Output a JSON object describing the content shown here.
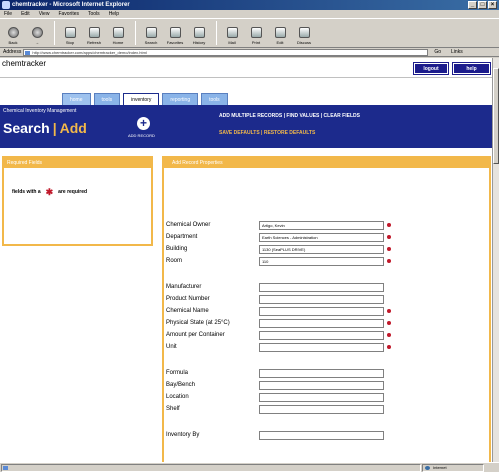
{
  "window": {
    "title": "chemtracker - Microsoft Internet Explorer",
    "controls": [
      "_",
      "□",
      "×"
    ]
  },
  "menu": [
    "File",
    "Edit",
    "View",
    "Favorites",
    "Tools",
    "Help"
  ],
  "toolbar": {
    "buttons": [
      "Back",
      "→",
      "Stop",
      "Refresh",
      "Home",
      "Search",
      "Favorites",
      "History",
      "Mail",
      "Print",
      "Edit",
      "Discuss"
    ]
  },
  "address": {
    "label": "Address",
    "url": "http://www.chemtracker.com/apps/chemtracker_demo/index.html",
    "go": "Go",
    "links": "Links"
  },
  "app": {
    "name": "chemtracker",
    "logout_label": "logout",
    "help_label": "help"
  },
  "tabs": [
    {
      "label": "home",
      "active": false
    },
    {
      "label": "tools",
      "active": false
    },
    {
      "label": "inventory",
      "active": true
    },
    {
      "label": "reporting",
      "active": false
    },
    {
      "label": "tools",
      "active": false
    }
  ],
  "banner": {
    "system": "Chemical Inventory Management",
    "crumb_search": "Search",
    "crumb_sep": "|",
    "crumb_add": "Add",
    "add_records_label": "ADD RECORD",
    "links_top": "ADD MULTIPLE RECORDS  |  FIND VALUES  |  CLEAR FIELDS",
    "links_bottom": "SAVE DEFAULTS  |  RESTORE DEFAULTS"
  },
  "left_panel": {
    "heading": "Required Fields",
    "req_prefix": "fields with a",
    "req_star": "✱",
    "req_suffix": "are required"
  },
  "form": {
    "heading": "Add Record Properties",
    "fields": [
      {
        "label": "Chemical Owner",
        "value": "Artigo, Kevin",
        "required": true
      },
      {
        "label": "Department",
        "value": "Earth Sciences - Administration",
        "required": true
      },
      {
        "label": "Building",
        "value": "1130 (SeaPLUS DRIVE)",
        "required": true
      },
      {
        "label": "Room",
        "value": "110",
        "required": true
      },
      {
        "label": "Manufacturer",
        "value": "",
        "required": false
      },
      {
        "label": "Product Number",
        "value": "",
        "required": false
      },
      {
        "label": "Chemical Name",
        "value": "",
        "required": true
      },
      {
        "label": "Physical State (at 25°C)",
        "value": "",
        "required": true
      },
      {
        "label": "Amount per Container",
        "value": "",
        "required": true
      },
      {
        "label": "Unit",
        "value": "",
        "required": true
      },
      {
        "label": "Formula",
        "value": "",
        "required": false
      },
      {
        "label": "Bay/Bench",
        "value": "",
        "required": false
      },
      {
        "label": "Location",
        "value": "",
        "required": false
      },
      {
        "label": "Shelf",
        "value": "",
        "required": false
      },
      {
        "label": "Inventory By",
        "value": "",
        "required": false
      }
    ]
  },
  "status": {
    "zone": "Internet"
  }
}
